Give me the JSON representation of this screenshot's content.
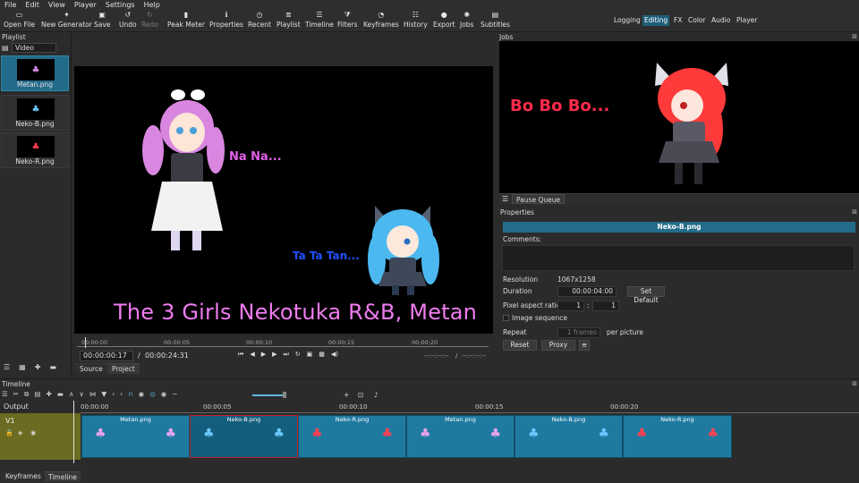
{
  "menu": [
    "File",
    "Edit",
    "View",
    "Player",
    "Settings",
    "Help"
  ],
  "toolbar": [
    {
      "label": "Open File",
      "icon": "open-icon"
    },
    {
      "label": "New Generator",
      "icon": "generator-icon"
    },
    {
      "label": "Save",
      "icon": "save-icon"
    },
    {
      "label": "Undo",
      "icon": "undo-icon"
    },
    {
      "label": "Redo",
      "icon": "redo-icon"
    },
    {
      "label": "Peak Meter",
      "icon": "peak-meter-icon"
    },
    {
      "label": "Properties",
      "icon": "properties-icon"
    },
    {
      "label": "Recent",
      "icon": "recent-icon"
    },
    {
      "label": "Playlist",
      "icon": "playlist-icon"
    },
    {
      "label": "Timeline",
      "icon": "timeline-icon"
    },
    {
      "label": "Filters",
      "icon": "filters-icon"
    },
    {
      "label": "Keyframes",
      "icon": "keyframes-icon"
    },
    {
      "label": "History",
      "icon": "history-icon"
    },
    {
      "label": "Export",
      "icon": "export-icon"
    },
    {
      "label": "Jobs",
      "icon": "jobs-icon"
    },
    {
      "label": "Subtitles",
      "icon": "subtitles-icon"
    }
  ],
  "layouts": [
    "Logging",
    "Editing",
    "FX",
    "Color",
    "Audio",
    "Player"
  ],
  "layout_active": "Editing",
  "playlist": {
    "title": "Playlist",
    "view_mode": "Video",
    "items": [
      "Metan.png",
      "Neko-B.png",
      "Neko-R.png"
    ]
  },
  "player": {
    "overlay_texts": {
      "na": "Na Na...",
      "ta": "Ta Ta Tan...",
      "title": "The 3 Girls Nekotuka R&B, Metan"
    },
    "ruler_labels": [
      "00:00:00",
      "00:00:05",
      "00:00:10",
      "00:00:15",
      "00:00:20"
    ],
    "current_time": "00:00:00:17",
    "total_time": "00:00:24:31",
    "in_point": "--:--:--:--",
    "out_point": "--:--:--:--",
    "tabs": [
      "Source",
      "Project"
    ]
  },
  "jobs": {
    "title": "Jobs",
    "overlay_text": "Bo Bo Bo...",
    "pause_queue": "Pause Queue"
  },
  "properties": {
    "title": "Properties",
    "filename": "Neko-B.png",
    "comments_label": "Comments:",
    "resolution_label": "Resolution",
    "resolution_value": "1067x1258",
    "duration_label": "Duration",
    "duration_value": "00:00:04:00",
    "set_default": "Set Default",
    "par_label": "Pixel aspect ratio",
    "par_num": "1",
    "par_sep": ":",
    "par_den": "1",
    "image_sequence": "Image sequence",
    "repeat_label": "Repeat",
    "repeat_value": "1 frames",
    "per_picture": "per picture",
    "reset": "Reset",
    "proxy": "Proxy"
  },
  "timeline": {
    "title": "Timeline",
    "output_label": "Output",
    "track": "V1",
    "ruler_labels": [
      "00:00:00",
      "00:00:05",
      "00:00:10",
      "00:00:15",
      "00:00:20"
    ],
    "clips": [
      {
        "label": "Metan.png",
        "sel": false
      },
      {
        "label": "Neko-B.png",
        "sel": true
      },
      {
        "label": "Neko-R.png",
        "sel": false
      },
      {
        "label": "Metan.png",
        "sel": false
      },
      {
        "label": "Neko-B.png",
        "sel": false
      },
      {
        "label": "Neko-R.png",
        "sel": false
      }
    ],
    "bottom_tabs": [
      "Keyframes",
      "Timeline"
    ]
  },
  "colors": {
    "accent": "#236b8a",
    "pink_text": "#e060e8",
    "blue_text": "#2050ff",
    "red_text": "#ff2a4a",
    "title_text": "#f07cf0"
  }
}
